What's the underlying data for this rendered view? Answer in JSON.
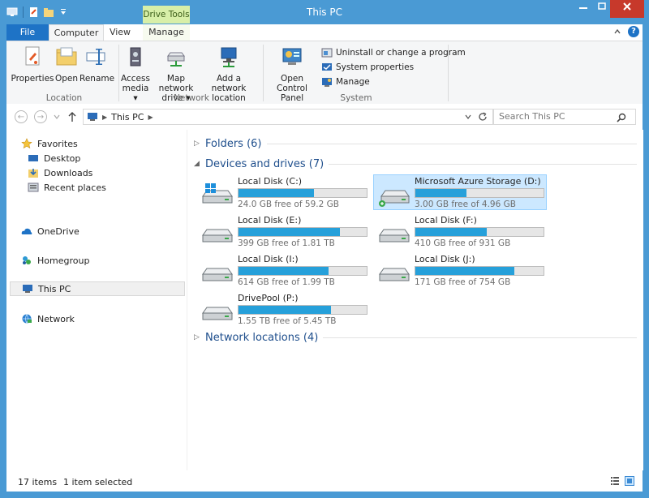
{
  "window": {
    "title": "This PC"
  },
  "ribbon_tabs": {
    "file": "File",
    "computer": "Computer",
    "view": "View",
    "manage": "Manage",
    "drive_tools": "Drive Tools"
  },
  "ribbon": {
    "properties": "Properties",
    "open": "Open",
    "rename": "Rename",
    "access_media_1": "Access",
    "access_media_2": "media ▾",
    "map_drive_1": "Map network",
    "map_drive_2": "drive ▾",
    "add_location_1": "Add a network",
    "add_location_2": "location",
    "control_panel_1": "Open Control",
    "control_panel_2": "Panel",
    "uninstall": "Uninstall or change a program",
    "system_properties": "System properties",
    "manage": "Manage",
    "group_location": "Location",
    "group_network": "Network",
    "group_system": "System"
  },
  "address": {
    "path": "This PC",
    "search_placeholder": "Search This PC"
  },
  "nav": {
    "favorites": "Favorites",
    "desktop": "Desktop",
    "downloads": "Downloads",
    "recent": "Recent places",
    "onedrive": "OneDrive",
    "homegroup": "Homegroup",
    "thispc": "This PC",
    "network": "Network"
  },
  "sections": {
    "folders": "Folders (6)",
    "devices": "Devices and drives (7)",
    "netloc": "Network locations (4)"
  },
  "drives": [
    {
      "name": "Local Disk (C:)",
      "free": "24.0 GB free of 59.2 GB",
      "used_fraction": 0.59
    },
    {
      "name": "Microsoft Azure Storage (D:)",
      "free": "3.00 GB free of 4.96 GB",
      "used_fraction": 0.4
    },
    {
      "name": "Local Disk (E:)",
      "free": "399 GB free of 1.81 TB",
      "used_fraction": 0.79
    },
    {
      "name": "Local Disk (F:)",
      "free": "410 GB free of 931 GB",
      "used_fraction": 0.56
    },
    {
      "name": "Local Disk (I:)",
      "free": "614 GB free of 1.99 TB",
      "used_fraction": 0.7
    },
    {
      "name": "Local Disk (J:)",
      "free": "171 GB free of 754 GB",
      "used_fraction": 0.77
    },
    {
      "name": "DrivePool (P:)",
      "free": "1.55 TB free of 5.45 TB",
      "used_fraction": 0.72
    }
  ],
  "status": {
    "items": "17 items",
    "selected": "1 item selected"
  },
  "colors": {
    "frame": "#4a9ad4",
    "accent": "#1e73c6",
    "bar_fill": "#26a0da",
    "close": "#c7392b",
    "drive_tools": "#d8efa8"
  }
}
